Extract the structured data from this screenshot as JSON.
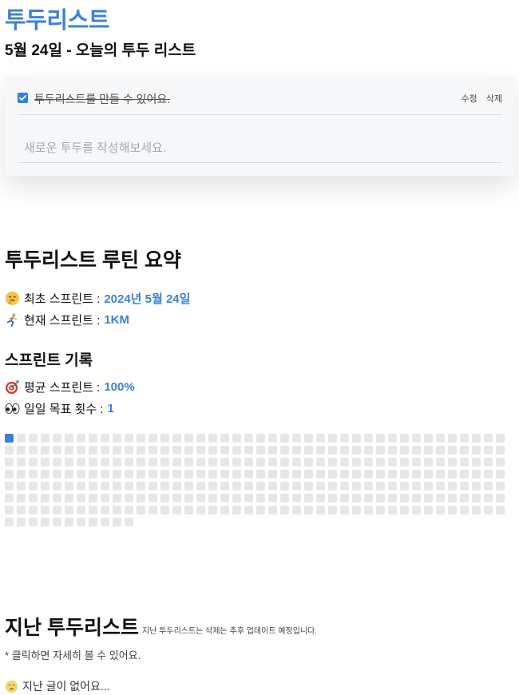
{
  "app": {
    "title": "투두리스트"
  },
  "today": {
    "heading": "5월 24일 - 오늘의 투두 리스트"
  },
  "todos": {
    "items": [
      {
        "text": "투두리스트를 만들 수 있어요.",
        "done": true,
        "edit_label": "수정",
        "delete_label": "삭제"
      }
    ],
    "new_placeholder": "새로운 투두를 작성해보세요."
  },
  "summary": {
    "title": "투두리스트 루틴 요약",
    "first_sprint": {
      "icon": "thinking-face-icon",
      "label": "최초 스프린트 :",
      "value": "2024년 5월 24일"
    },
    "current_sprint": {
      "icon": "running-person-icon",
      "label": "현재 스프린트 :",
      "value": "1KM"
    }
  },
  "records": {
    "title": "스프린트 기록",
    "avg_sprint": {
      "icon": "direct-hit-icon",
      "label": "평균 스프린트 :",
      "value": "100%"
    },
    "daily_goal": {
      "icon": "eyes-icon",
      "label": "일일 목표 횟수 :",
      "value": "1"
    }
  },
  "heatmap": {
    "total_cells": 305,
    "active_cells": [
      0
    ],
    "active_color": "#3d7ed8",
    "inactive_color": "#e7e7e9"
  },
  "past": {
    "title": "지난 투두리스트",
    "note": "지난 투두리스트는 삭제는 추후 업데이트 예정입니다.",
    "hint": "* 클릭하면 자세히 볼 수 있어요.",
    "empty_icon": "sad-face-icon",
    "empty_text": "지난 글이 없어요..."
  },
  "colors": {
    "accent": "#3b82d6",
    "checkbox": "#2f7fe6"
  }
}
